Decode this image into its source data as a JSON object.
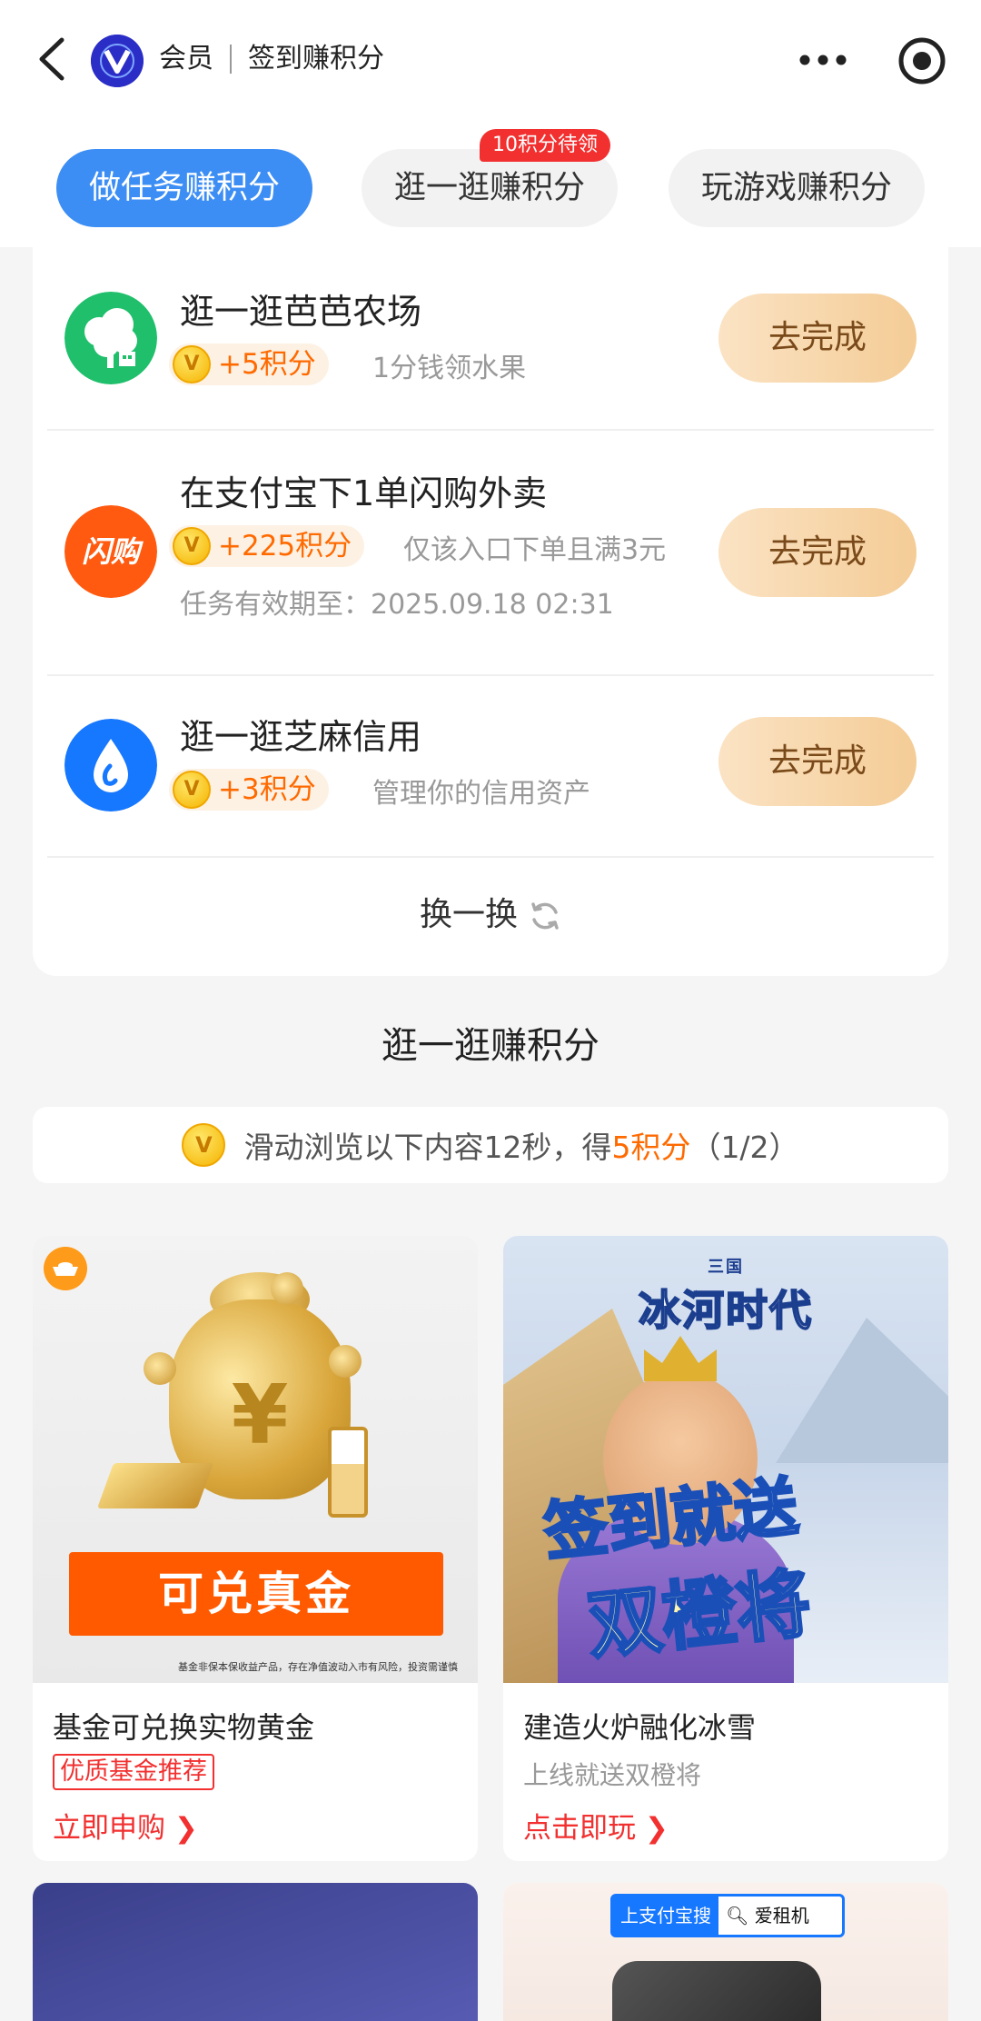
{
  "nav": {
    "brand": "会员",
    "title": "签到赚积分"
  },
  "tabs": [
    {
      "label": "做任务赚积分",
      "active": true
    },
    {
      "label": "逛一逛赚积分",
      "badge": "10积分待领"
    },
    {
      "label": "玩游戏赚积分"
    }
  ],
  "tasks": [
    {
      "title": "逛一逛芭芭农场",
      "points": "+5积分",
      "desc": "1分钱领水果",
      "button": "去完成",
      "icon": "farm-tree-icon",
      "color": "#1fbf6b"
    },
    {
      "title": "在支付宝下1单闪购外卖",
      "points": "+225积分",
      "desc": "仅该入口下单且满3元",
      "sub": "任务有效期至：2025.09.18 02:31",
      "button": "去完成",
      "icon": "shangou-icon",
      "icon_text": "闪购",
      "color": "#ff5a10"
    },
    {
      "title": "逛一逛芝麻信用",
      "points": "+3积分",
      "desc": "管理你的信用资产",
      "button": "去完成",
      "icon": "sesame-credit-icon",
      "color": "#1677ff"
    }
  ],
  "refresh_label": "换一换",
  "browse": {
    "section_title": "逛一逛赚积分",
    "prefix": "滑动浏览以下内容12秒，得",
    "reward": "5积分",
    "progress": "（1/2）"
  },
  "feed": [
    {
      "banner": "可兑真金",
      "disclaimer": "基金非保本保收益产品，存在净值波动入市有风险，投资需谨慎",
      "title": "基金可兑换实物黄金",
      "tag": "优质基金推荐",
      "link": "立即申购"
    },
    {
      "logo_small": "三国",
      "logo": "冰河时代",
      "headline1": "签到就送",
      "headline2": "双橙将",
      "title": "建造火炉融化冰雪",
      "sub": "上线就送双橙将",
      "link": "点击即玩"
    },
    {},
    {
      "search_left": "上支付宝搜",
      "search_right": "爱租机"
    }
  ]
}
